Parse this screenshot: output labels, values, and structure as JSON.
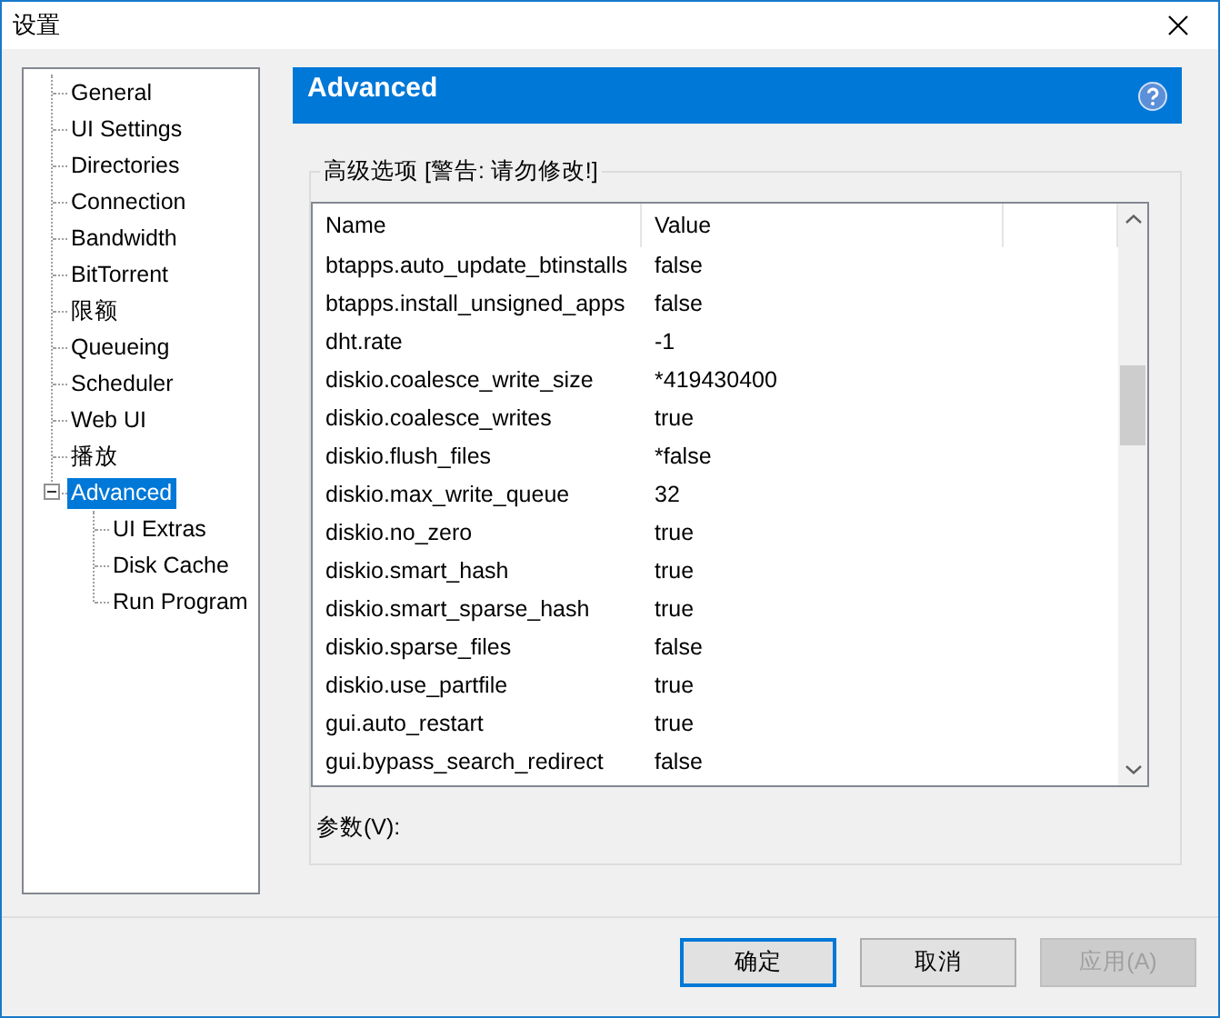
{
  "window": {
    "title": "设置"
  },
  "tree": [
    {
      "label": "General",
      "selected": false
    },
    {
      "label": "UI Settings",
      "selected": false
    },
    {
      "label": "Directories",
      "selected": false
    },
    {
      "label": "Connection",
      "selected": false
    },
    {
      "label": "Bandwidth",
      "selected": false
    },
    {
      "label": "BitTorrent",
      "selected": false
    },
    {
      "label": "限额",
      "selected": false
    },
    {
      "label": "Queueing",
      "selected": false
    },
    {
      "label": "Scheduler",
      "selected": false
    },
    {
      "label": "Web UI",
      "selected": false
    },
    {
      "label": "播放",
      "selected": false
    },
    {
      "label": "Advanced",
      "selected": true,
      "expanded": true,
      "children": [
        {
          "label": "UI Extras",
          "selected": false
        },
        {
          "label": "Disk Cache",
          "selected": false
        },
        {
          "label": "Run Program",
          "selected": false
        }
      ]
    }
  ],
  "panel": {
    "title": "Advanced",
    "group_title": "高级选项 [警告: 请勿修改!]"
  },
  "table": {
    "columns": [
      "Name",
      "Value"
    ],
    "rows": [
      [
        "btapps.auto_update_btinstalls",
        "false"
      ],
      [
        "btapps.install_unsigned_apps",
        "false"
      ],
      [
        "dht.rate",
        "-1"
      ],
      [
        "diskio.coalesce_write_size",
        "*419430400"
      ],
      [
        "diskio.coalesce_writes",
        "true"
      ],
      [
        "diskio.flush_files",
        "*false"
      ],
      [
        "diskio.max_write_queue",
        "32"
      ],
      [
        "diskio.no_zero",
        "true"
      ],
      [
        "diskio.smart_hash",
        "true"
      ],
      [
        "diskio.smart_sparse_hash",
        "true"
      ],
      [
        "diskio.sparse_files",
        "false"
      ],
      [
        "diskio.use_partfile",
        "true"
      ],
      [
        "gui.auto_restart",
        "true"
      ],
      [
        "gui.bypass_search_redirect",
        "false"
      ]
    ]
  },
  "value_label": "参数(V):",
  "buttons": [
    {
      "label": "确定",
      "disabled": false,
      "default": true
    },
    {
      "label": "取消",
      "disabled": false,
      "default": false
    },
    {
      "label": "应用(A)",
      "disabled": true,
      "default": false
    }
  ]
}
